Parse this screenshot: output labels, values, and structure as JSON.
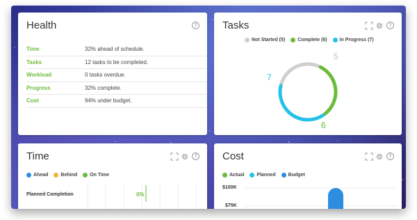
{
  "colors": {
    "green": "#6cbb3c",
    "cyan": "#27c1e8",
    "gray": "#cfcfcf",
    "yellow": "#f2b33a",
    "blue": "#2d8ee0"
  },
  "health": {
    "title": "Health",
    "rows": [
      {
        "label": "Time",
        "value": "32% ahead of schedule."
      },
      {
        "label": "Tasks",
        "value": "12 tasks to be completed."
      },
      {
        "label": "Workload",
        "value": "0 tasks overdue."
      },
      {
        "label": "Progress",
        "value": "32% complete."
      },
      {
        "label": "Cost",
        "value": "94% under budget."
      }
    ]
  },
  "tasks": {
    "title": "Tasks",
    "legend": [
      {
        "label": "Not Started (5)",
        "color": "#cfcfcf"
      },
      {
        "label": "Complete (6)",
        "color": "#6cbb3c"
      },
      {
        "label": "In Progress (7)",
        "color": "#27c1e8"
      }
    ],
    "chart_data": {
      "type": "pie",
      "labels": [
        "Not Started",
        "Complete",
        "In Progress"
      ],
      "values": [
        5,
        6,
        7
      ]
    },
    "value_labels": {
      "not_started": "5",
      "complete": "6",
      "in_progress": "7"
    }
  },
  "time": {
    "title": "Time",
    "legend": [
      {
        "label": "Ahead",
        "color": "#2d8ee0"
      },
      {
        "label": "Behind",
        "color": "#f2b33a"
      },
      {
        "label": "On Time",
        "color": "#6cbb3c"
      }
    ],
    "row_label": "Planned Completion",
    "row_value": "0%"
  },
  "cost": {
    "title": "Cost",
    "legend": [
      {
        "label": "Actual",
        "color": "#6cbb3c"
      },
      {
        "label": "Planned",
        "color": "#27c1e8"
      },
      {
        "label": "Budget",
        "color": "#2d8ee0"
      }
    ],
    "y_ticks": [
      "$100K",
      "$75K"
    ]
  }
}
